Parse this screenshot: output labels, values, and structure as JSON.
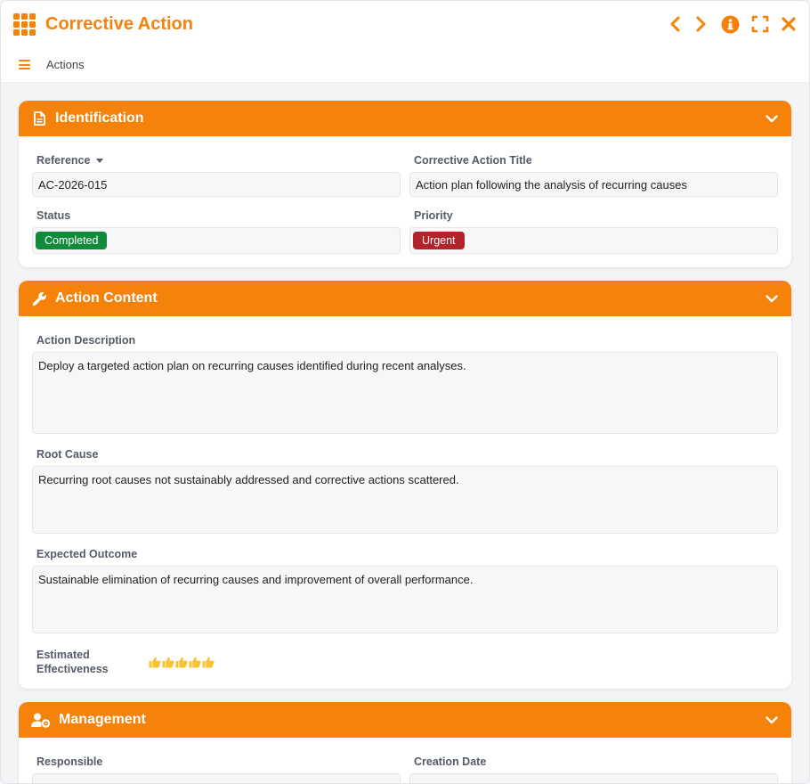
{
  "window": {
    "title": "Corrective Action",
    "menu_label": "Actions"
  },
  "colors": {
    "accent": "#f5820b",
    "status_completed": "#118a3b",
    "priority_urgent": "#b3232b",
    "rating": "#f7c32e"
  },
  "identification": {
    "title": "Identification",
    "reference_label": "Reference",
    "reference_value": "AC-2026-015",
    "action_title_label": "Corrective Action Title",
    "action_title_value": "Action plan following the analysis of recurring causes",
    "status_label": "Status",
    "status_value": "Completed",
    "priority_label": "Priority",
    "priority_value": "Urgent"
  },
  "action_content": {
    "title": "Action Content",
    "description_label": "Action Description",
    "description_value": "Deploy a targeted action plan on recurring causes identified during recent analyses.",
    "root_cause_label": "Root Cause",
    "root_cause_value": "Recurring root causes not sustainably addressed and corrective actions scattered.",
    "expected_outcome_label": "Expected Outcome",
    "expected_outcome_value": "Sustainable elimination of recurring causes and improvement of overall performance.",
    "effectiveness_label_line1": "Estimated",
    "effectiveness_label_line2": "Effectiveness",
    "effectiveness_rating": 5,
    "effectiveness_max": 5
  },
  "management": {
    "title": "Management",
    "responsible_label": "Responsible",
    "creation_date_label": "Creation Date"
  }
}
